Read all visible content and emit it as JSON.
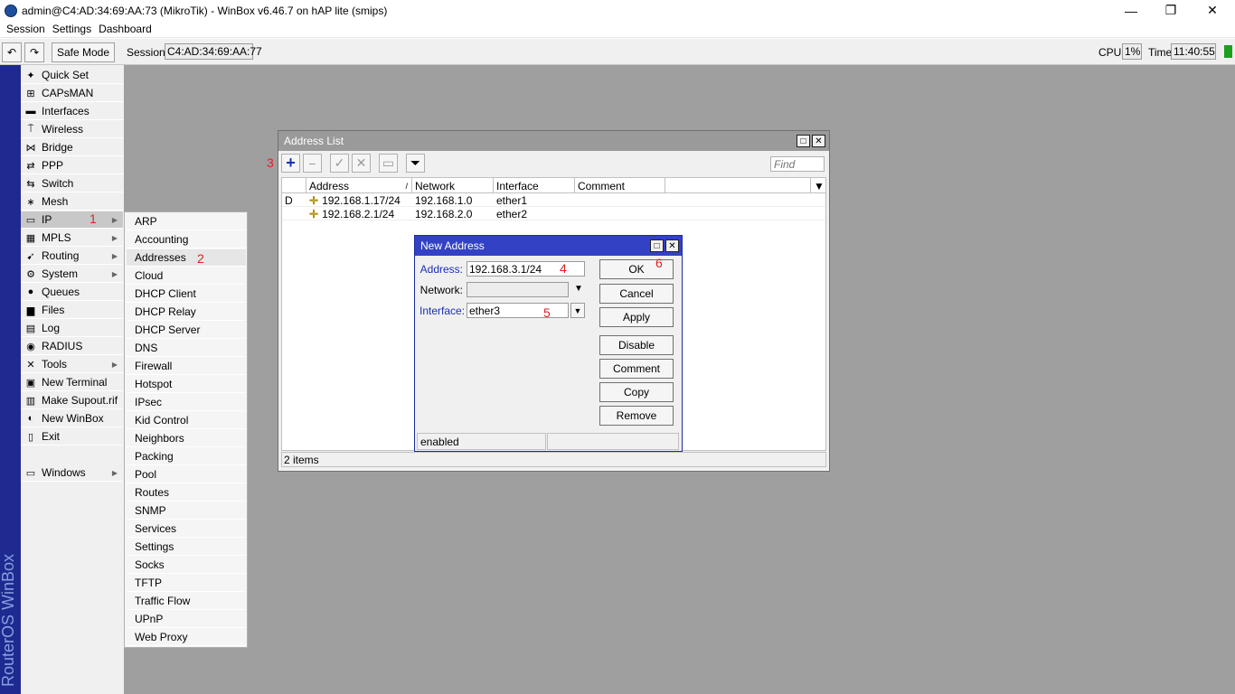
{
  "window": {
    "title": "admin@C4:AD:34:69:AA:73 (MikroTik) - WinBox v6.46.7 on hAP lite (smips)",
    "minimize_glyph": "—",
    "maximize_glyph": "❐",
    "close_glyph": "✕"
  },
  "menubar": [
    "Session",
    "Settings",
    "Dashboard"
  ],
  "toolbar": {
    "undo_glyph": "↶",
    "redo_glyph": "↷",
    "safe_mode_label": "Safe Mode",
    "session_label": "Session:",
    "session_value": "C4:AD:34:69:AA:77",
    "cpu_label": "CPU:",
    "cpu_value": "1%",
    "time_label": "Time:",
    "time_value": "11:40:55"
  },
  "brand": "RouterOS WinBox",
  "main_menu": [
    {
      "label": "Quick Set",
      "icon": "wand-icon",
      "glyph": "✦",
      "arrow": false
    },
    {
      "label": "CAPsMAN",
      "icon": "capsman-icon",
      "glyph": "⊞",
      "arrow": false
    },
    {
      "label": "Interfaces",
      "icon": "interfaces-icon",
      "glyph": "▬",
      "arrow": false
    },
    {
      "label": "Wireless",
      "icon": "wireless-icon",
      "glyph": "⍑",
      "arrow": false
    },
    {
      "label": "Bridge",
      "icon": "bridge-icon",
      "glyph": "⋈",
      "arrow": false
    },
    {
      "label": "PPP",
      "icon": "ppp-icon",
      "glyph": "⇄",
      "arrow": false
    },
    {
      "label": "Switch",
      "icon": "switch-icon",
      "glyph": "⇆",
      "arrow": false
    },
    {
      "label": "Mesh",
      "icon": "mesh-icon",
      "glyph": "∗",
      "arrow": false
    },
    {
      "label": "IP",
      "icon": "ip-icon",
      "glyph": "▭",
      "arrow": true
    },
    {
      "label": "MPLS",
      "icon": "mpls-icon",
      "glyph": "▦",
      "arrow": true
    },
    {
      "label": "Routing",
      "icon": "routing-icon",
      "glyph": "➹",
      "arrow": true
    },
    {
      "label": "System",
      "icon": "system-gear-icon",
      "glyph": "⚙",
      "arrow": true
    },
    {
      "label": "Queues",
      "icon": "queues-icon",
      "glyph": "●",
      "arrow": false
    },
    {
      "label": "Files",
      "icon": "files-icon",
      "glyph": "▆",
      "arrow": false
    },
    {
      "label": "Log",
      "icon": "log-icon",
      "glyph": "▤",
      "arrow": false
    },
    {
      "label": "RADIUS",
      "icon": "radius-icon",
      "glyph": "◉",
      "arrow": false
    },
    {
      "label": "Tools",
      "icon": "tools-icon",
      "glyph": "✕",
      "arrow": true
    },
    {
      "label": "New Terminal",
      "icon": "terminal-icon",
      "glyph": "▣",
      "arrow": false
    },
    {
      "label": "Make Supout.rif",
      "icon": "supout-icon",
      "glyph": "▥",
      "arrow": false
    },
    {
      "label": "New WinBox",
      "icon": "winbox-icon",
      "glyph": "◐",
      "arrow": false
    },
    {
      "label": "Exit",
      "icon": "exit-icon",
      "glyph": "▯",
      "arrow": false
    },
    {
      "label": "Windows",
      "icon": "windows-icon",
      "glyph": "▭",
      "arrow": true
    }
  ],
  "ip_submenu": [
    "ARP",
    "Accounting",
    "Addresses",
    "Cloud",
    "DHCP Client",
    "DHCP Relay",
    "DHCP Server",
    "DNS",
    "Firewall",
    "Hotspot",
    "IPsec",
    "Kid Control",
    "Neighbors",
    "Packing",
    "Pool",
    "Routes",
    "SNMP",
    "Services",
    "Settings",
    "Socks",
    "TFTP",
    "Traffic Flow",
    "UPnP",
    "Web Proxy"
  ],
  "steps": [
    "1",
    "2",
    "3",
    "4",
    "5",
    "6"
  ],
  "address_list": {
    "title": "Address List",
    "find_placeholder": "Find",
    "columns": [
      "Address",
      "Network",
      "Interface",
      "Comment"
    ],
    "rows": [
      {
        "flag": "D",
        "address": "192.168.1.17/24",
        "network": "192.168.1.0",
        "interface": "ether1",
        "comment": ""
      },
      {
        "flag": "",
        "address": "192.168.2.1/24",
        "network": "192.168.2.0",
        "interface": "ether2",
        "comment": ""
      }
    ],
    "status": "2 items"
  },
  "new_address": {
    "title": "New Address",
    "address_label": "Address:",
    "address_value": "192.168.3.1/24",
    "network_label": "Network:",
    "network_value": "",
    "interface_label": "Interface:",
    "interface_value": "ether3",
    "buttons": [
      "OK",
      "Cancel",
      "Apply",
      "Disable",
      "Comment",
      "Copy",
      "Remove"
    ],
    "status": "enabled"
  },
  "colors": {
    "brand_strip": "#1e2a8f",
    "active_title": "#3342c4",
    "inactive_title": "#9a9a9a",
    "step_marker": "#e02020",
    "workspace": "#9f9f9f"
  }
}
